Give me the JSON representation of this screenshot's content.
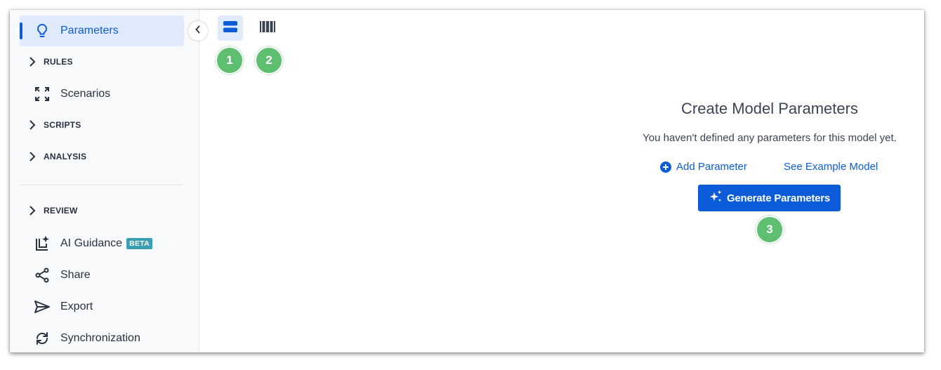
{
  "sidebar": {
    "active_item": "Parameters",
    "items": [
      {
        "type": "item",
        "label": "Parameters",
        "icon": "lightbulb-icon",
        "active": true
      },
      {
        "type": "section",
        "label": "RULES"
      },
      {
        "type": "item",
        "label": "Scenarios",
        "icon": "expand-arrows-icon"
      },
      {
        "type": "section",
        "label": "SCRIPTS"
      },
      {
        "type": "section",
        "label": "ANALYSIS"
      },
      {
        "type": "section",
        "label": "REVIEW"
      },
      {
        "type": "item",
        "label": "AI Guidance",
        "icon": "ai-guidance-icon",
        "badge": "BETA"
      },
      {
        "type": "item",
        "label": "Share",
        "icon": "share-icon"
      },
      {
        "type": "item",
        "label": "Export",
        "icon": "send-icon"
      },
      {
        "type": "item",
        "label": "Synchronization",
        "icon": "sync-icon"
      }
    ]
  },
  "toolbar": {
    "view_buttons": [
      {
        "icon": "list-view-icon",
        "selected": true
      },
      {
        "icon": "column-view-icon",
        "selected": false
      }
    ]
  },
  "step_badges": [
    "1",
    "2",
    "3"
  ],
  "empty_state": {
    "title": "Create Model Parameters",
    "description": "You haven't defined any parameters for this model yet.",
    "add_link": "Add Parameter",
    "example_link": "See Example Model",
    "generate_button": "Generate Parameters"
  },
  "colors": {
    "accent": "#0c5cda",
    "active_bg": "#dfeafc",
    "badge_green": "#5dbf6f",
    "beta_badge": "#3b9fb1"
  }
}
